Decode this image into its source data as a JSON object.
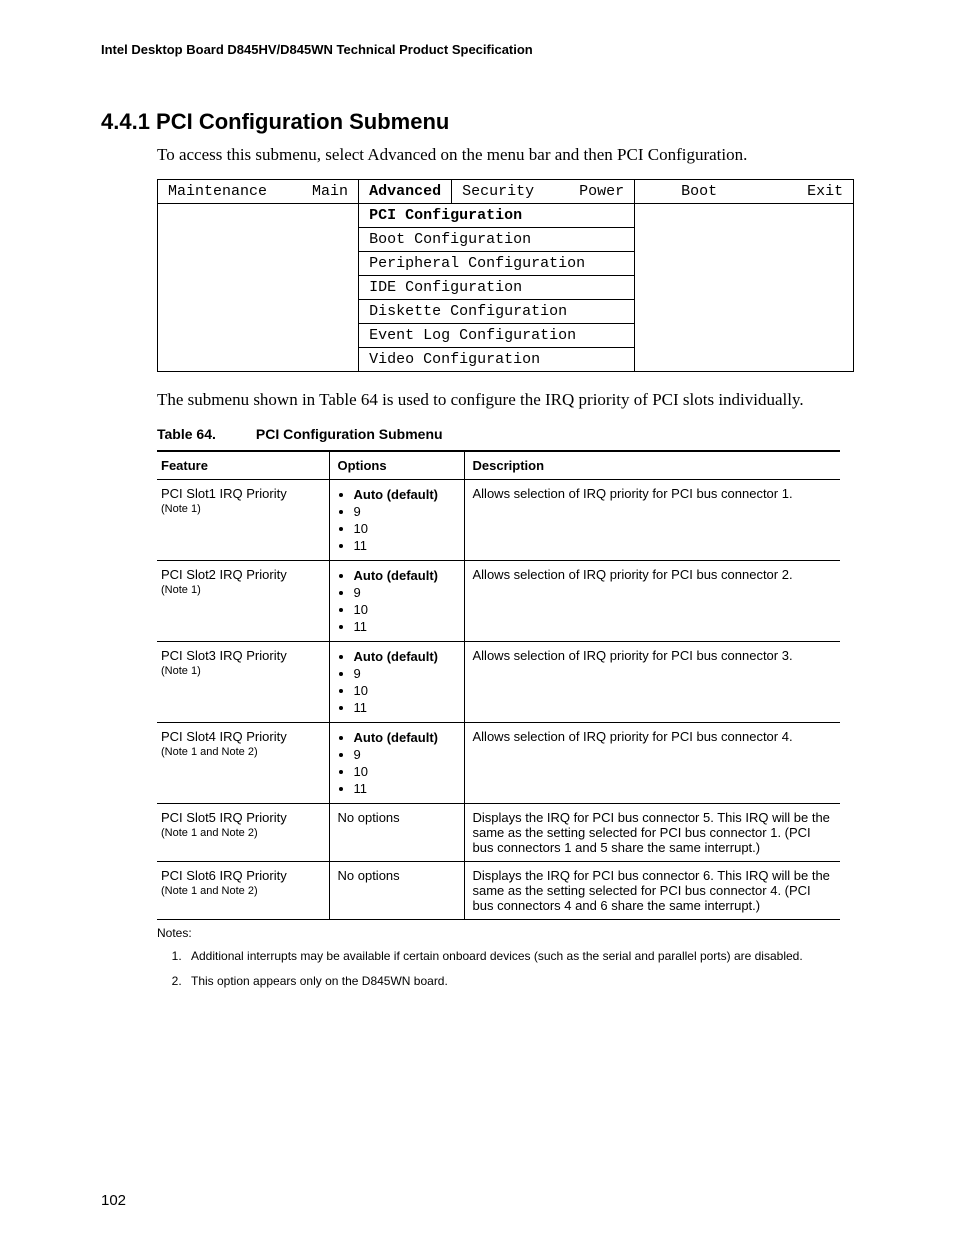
{
  "header": {
    "running_head": "Intel Desktop Board D845HV/D845WN Technical Product Specification"
  },
  "section": {
    "number_title": "4.4.1   PCI Configuration Submenu",
    "intro": "To access this submenu, select Advanced on the menu bar and then PCI Configuration."
  },
  "bios_menu": {
    "tabs": [
      "Maintenance",
      "Main",
      "Advanced",
      "Security",
      "Power",
      "Boot",
      "Exit"
    ],
    "active_tab": "Advanced",
    "submenu_items": [
      "PCI Configuration",
      "Boot Configuration",
      "Peripheral Configuration",
      "IDE Configuration",
      "Diskette Configuration",
      "Event Log Configuration",
      "Video Configuration"
    ]
  },
  "submenu_desc": "The submenu shown in Table 64 is used to configure the IRQ priority of PCI slots individually.",
  "table_caption": {
    "label": "Table 64.",
    "title": "PCI Configuration Submenu"
  },
  "table": {
    "headers": [
      "Feature",
      "Options",
      "Description"
    ],
    "rows": [
      {
        "feature": "PCI Slot1 IRQ Priority",
        "note": "(Note 1)",
        "options": [
          "Auto (default)",
          "9",
          "10",
          "11"
        ],
        "default_index": 0,
        "no_options": false,
        "description": "Allows selection of IRQ priority for PCI bus connector 1."
      },
      {
        "feature": "PCI Slot2 IRQ Priority",
        "note": "(Note 1)",
        "options": [
          "Auto (default)",
          "9",
          "10",
          "11"
        ],
        "default_index": 0,
        "no_options": false,
        "description": "Allows selection of IRQ priority for PCI bus connector 2."
      },
      {
        "feature": "PCI Slot3 IRQ Priority",
        "note": "(Note 1)",
        "options": [
          "Auto (default)",
          "9",
          "10",
          "11"
        ],
        "default_index": 0,
        "no_options": false,
        "description": "Allows selection of IRQ priority for PCI bus connector 3."
      },
      {
        "feature": "PCI Slot4 IRQ Priority",
        "note": "(Note 1 and Note 2)",
        "options": [
          "Auto (default)",
          "9",
          "10",
          "11"
        ],
        "default_index": 0,
        "no_options": false,
        "description": "Allows selection of IRQ priority for PCI bus connector 4."
      },
      {
        "feature": "PCI Slot5 IRQ Priority",
        "note": "(Note 1 and Note 2)",
        "options": [],
        "no_options": true,
        "no_options_text": "No options",
        "description": "Displays the IRQ for PCI bus connector 5.  This IRQ will be the same as the setting selected for PCI bus connector 1.  (PCI bus connectors 1 and 5 share the same interrupt.)"
      },
      {
        "feature": "PCI Slot6 IRQ Priority",
        "note": "(Note 1 and Note 2)",
        "options": [],
        "no_options": true,
        "no_options_text": "No options",
        "description": "Displays the IRQ for PCI bus connector 6.  This IRQ will be the same as the setting selected for PCI bus connector 4.  (PCI bus connectors 4 and 6 share the same interrupt.)"
      }
    ]
  },
  "notes": {
    "label": "Notes:",
    "items": [
      "Additional interrupts may be available if certain onboard devices (such as the serial and parallel ports) are disabled.",
      "This option appears only on the D845WN board."
    ]
  },
  "page_number": "102"
}
